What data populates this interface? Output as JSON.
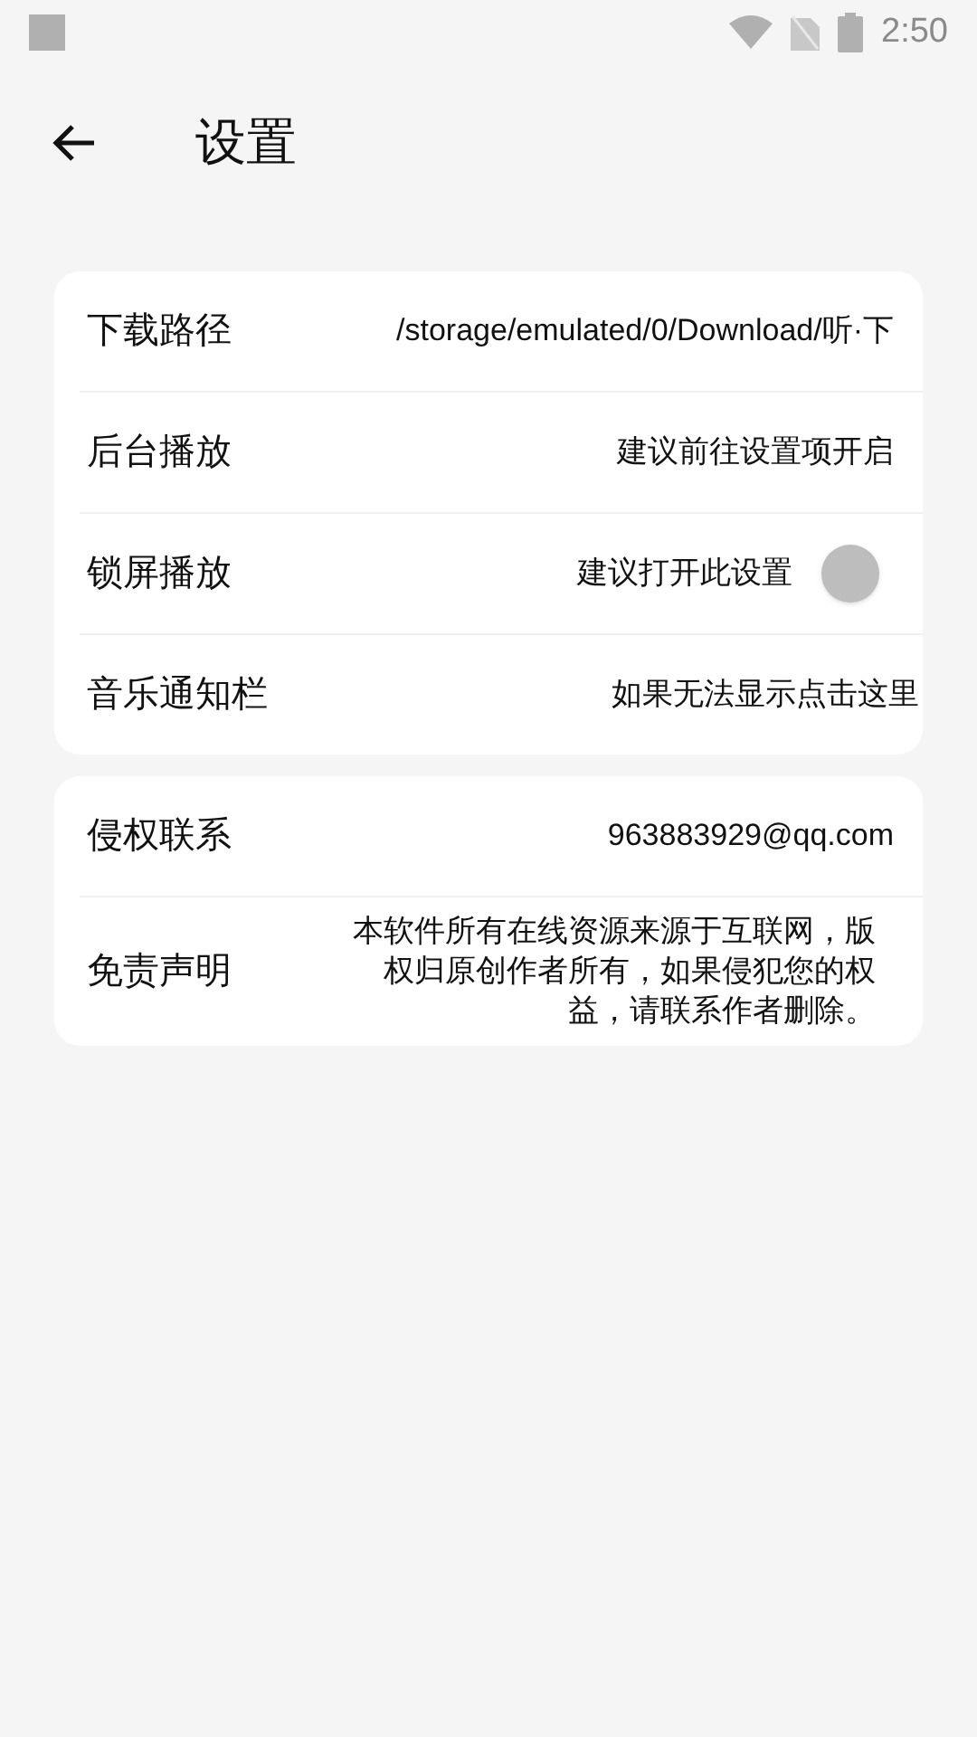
{
  "status_bar": {
    "time": "2:50"
  },
  "header": {
    "title": "设置"
  },
  "groups": [
    {
      "rows": [
        {
          "kind": "text",
          "label": "下载路径",
          "value": "/storage/emulated/0/Download/听·下"
        },
        {
          "kind": "text",
          "label": "后台播放",
          "value": "建议前往设置项开启"
        },
        {
          "kind": "switch",
          "label": "锁屏播放",
          "value": "建议打开此设置",
          "on": false
        },
        {
          "kind": "text",
          "label": "音乐通知栏",
          "value": "如果无法显示点击这里"
        }
      ]
    },
    {
      "rows": [
        {
          "kind": "text",
          "label": "侵权联系",
          "value": "963883929@qq.com"
        },
        {
          "kind": "paragraph",
          "label": "免责声明",
          "value": "本软件所有在线资源来源于互联网，版权归原创作者所有，如果侵犯您的权益，请联系作者删除。"
        }
      ]
    }
  ]
}
